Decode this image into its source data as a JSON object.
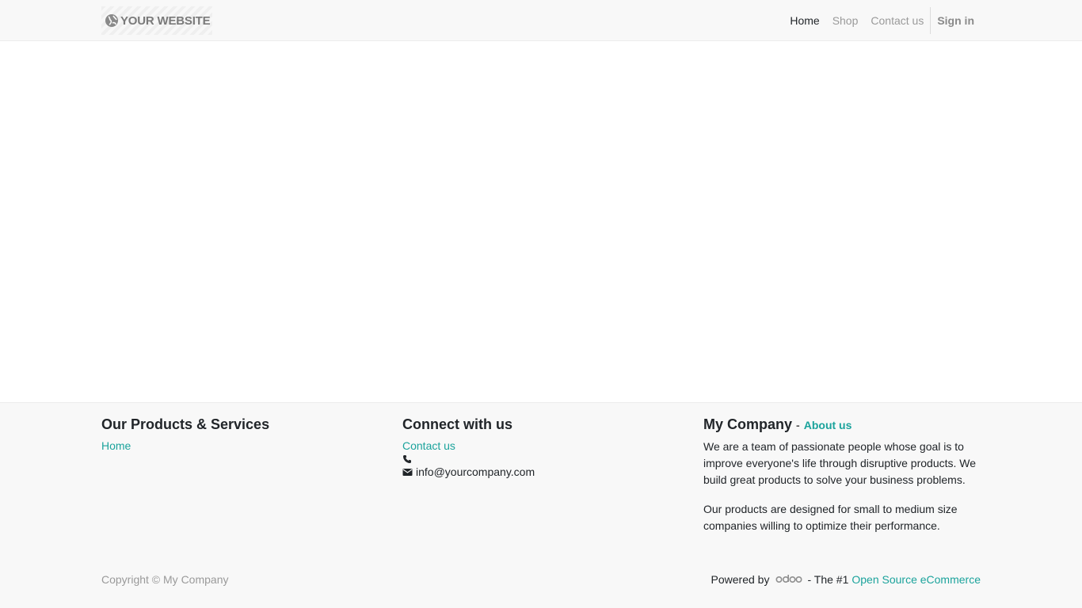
{
  "header": {
    "logo_text": "YOUR WEBSITE",
    "nav": [
      {
        "label": "Home"
      },
      {
        "label": "Shop"
      },
      {
        "label": "Contact us"
      }
    ],
    "sign_in_label": "Sign in"
  },
  "footer": {
    "products": {
      "title": "Our Products & Services",
      "links": [
        {
          "label": "Home"
        }
      ]
    },
    "connect": {
      "title": "Connect with us",
      "contact_label": "Contact us",
      "phone": "",
      "email": "info@yourcompany.com"
    },
    "company": {
      "title": "My Company",
      "separator": "-",
      "about_label": "About us",
      "paragraphs": [
        "We are a team of passionate people whose goal is to improve everyone's life through disruptive products. We build great products to solve your business problems.",
        "Our products are designed for small to medium size companies willing to optimize their performance."
      ]
    },
    "copyright": "Copyright © My Company",
    "powered_by": "Powered by",
    "tagline": "- The #1",
    "tagline_link": "Open Source eCommerce"
  },
  "colors": {
    "accent": "#1ba39c",
    "bar_background": "#f8f8f8"
  },
  "icons": {
    "logo": "globe-icon",
    "phone": "phone-icon",
    "email": "envelope-icon",
    "odoo": "odoo-logo"
  }
}
